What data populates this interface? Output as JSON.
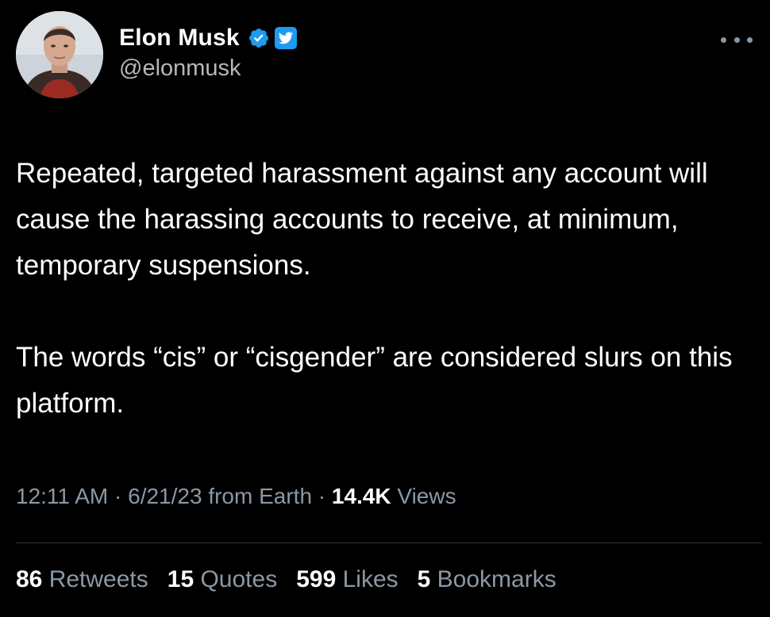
{
  "author": {
    "display_name": "Elon Musk",
    "handle": "@elonmusk",
    "avatar_icon": "profile-photo",
    "verified_icon": "verified-badge-icon",
    "platform_icon": "twitter-bird-icon"
  },
  "more_icon": "ellipsis-icon",
  "tweet": {
    "paragraph1": "Repeated, targeted harassment against any account will cause the harassing accounts to receive, at minimum, temporary suspensions.",
    "paragraph2": "The words “cis” or “cisgender” are considered slurs on this platform."
  },
  "meta": {
    "time": "12:11 AM",
    "separator1": " · ",
    "date": "6/21/23",
    "source": " from Earth",
    "separator2": " · ",
    "views_count": "14.4K",
    "views_label": " Views"
  },
  "stats": {
    "retweets_count": "86",
    "retweets_label": " Retweets",
    "quotes_count": "15",
    "quotes_label": " Quotes",
    "likes_count": "599",
    "likes_label": " Likes",
    "bookmarks_count": "5",
    "bookmarks_label": " Bookmarks"
  },
  "colors": {
    "background": "#000000",
    "text_primary": "#ffffff",
    "text_secondary": "#8b98a5",
    "verified_blue": "#1d9bf0",
    "divider": "#2f3336"
  }
}
